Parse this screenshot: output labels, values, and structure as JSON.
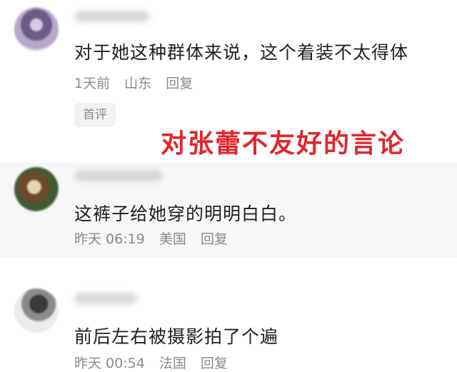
{
  "comments": [
    {
      "text": "对于她这种群体来说，这个着装不太得体",
      "time": "1天前",
      "location": "山东",
      "reply": "回复",
      "badge": "首评"
    },
    {
      "text": "这裤子给她穿的明明白白。",
      "time": "昨天 06:19",
      "location": "美国",
      "reply": "回复"
    },
    {
      "text": "前后左右被摄影拍了个遍",
      "time": "昨天 00:54",
      "location": "法国",
      "reply": "回复"
    }
  ],
  "annotation": "对张蕾不友好的言论"
}
